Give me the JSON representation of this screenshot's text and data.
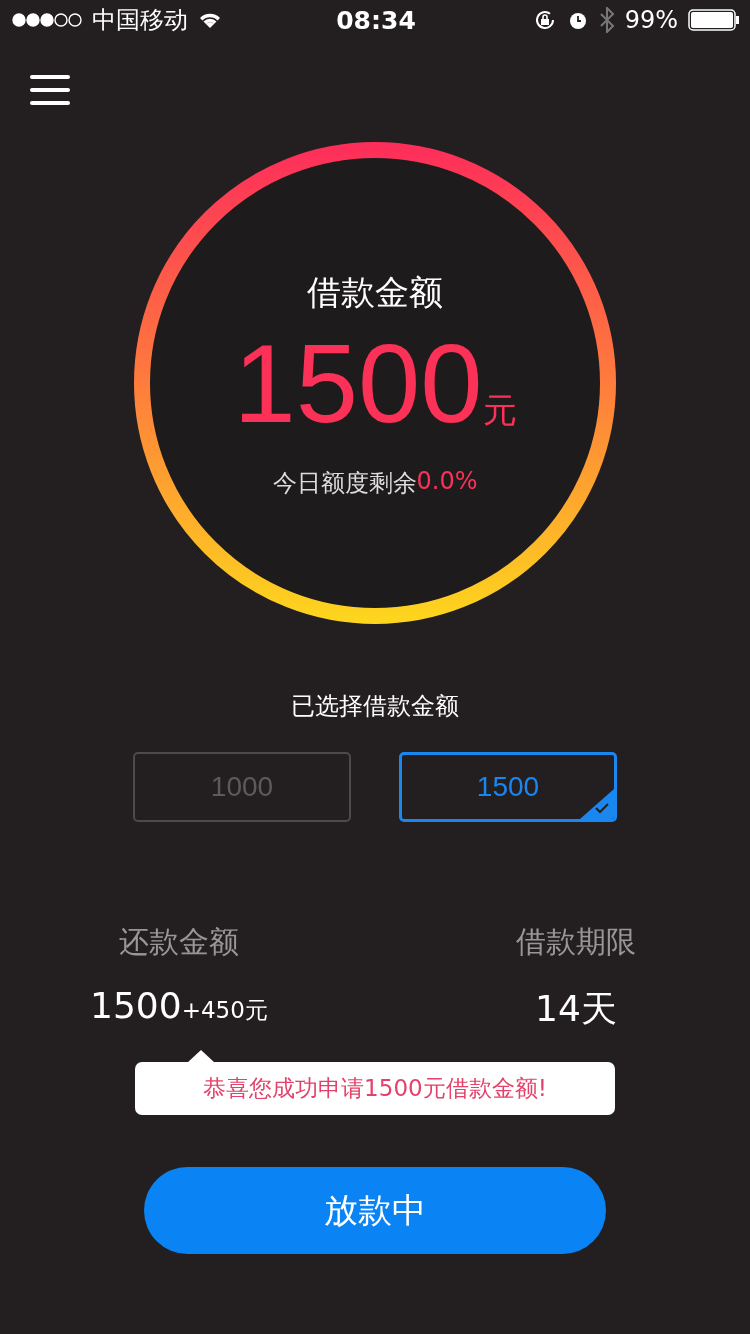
{
  "status_bar": {
    "carrier": "中国移动",
    "time": "08:34",
    "battery": "99%"
  },
  "loan_ring": {
    "title": "借款金额",
    "amount": "1500",
    "unit": "元",
    "remaining_label": "今日额度剩余",
    "remaining_value": "0.0%"
  },
  "selection": {
    "title": "已选择借款金额",
    "options": [
      {
        "label": "1000",
        "selected": false
      },
      {
        "label": "1500",
        "selected": true
      }
    ]
  },
  "summary": [
    {
      "label": "还款金额",
      "value": "1500",
      "extra": "+450元"
    },
    {
      "label": "借款期限",
      "value": "14天"
    }
  ],
  "tooltip": "恭喜您成功申请1500元借款金额!",
  "action_button": "放款中"
}
